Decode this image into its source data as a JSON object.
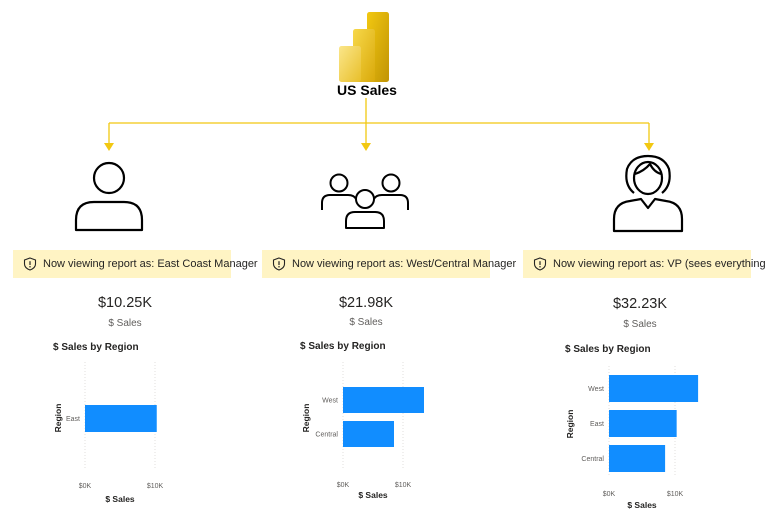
{
  "app": {
    "title": "US Sales",
    "icon": "power-bi-logo-icon",
    "connector_color": "#F2C811"
  },
  "personas": [
    {
      "id": "east",
      "icon": "single-person-icon",
      "banner": "Now viewing report as: East Coast Manager",
      "card": {
        "value": "$10.25K",
        "label": "$ Sales"
      }
    },
    {
      "id": "west",
      "icon": "group-people-icon",
      "banner": "Now viewing report as: West/Central Manager",
      "card": {
        "value": "$21.98K",
        "label": "$ Sales"
      }
    },
    {
      "id": "vp",
      "icon": "woman-person-icon",
      "banner": "Now viewing report as: VP (sees everything)",
      "card": {
        "value": "$32.23K",
        "label": "$ Sales"
      }
    }
  ],
  "chart_data": [
    {
      "type": "bar",
      "orientation": "horizontal",
      "title": "$ Sales by Region",
      "xlabel": "$ Sales",
      "ylabel": "Region",
      "categories": [
        "East"
      ],
      "values": [
        10.25
      ],
      "x_ticks": [
        "$0K",
        "$10K"
      ],
      "xlim": [
        0,
        10
      ],
      "grid": true,
      "bar_color": "#118DFF"
    },
    {
      "type": "bar",
      "orientation": "horizontal",
      "title": "$ Sales by Region",
      "xlabel": "$ Sales",
      "ylabel": "Region",
      "categories": [
        "West",
        "Central"
      ],
      "values": [
        13.5,
        8.5
      ],
      "x_ticks": [
        "$0K",
        "$10K"
      ],
      "xlim": [
        0,
        10
      ],
      "grid": true,
      "bar_color": "#118DFF"
    },
    {
      "type": "bar",
      "orientation": "horizontal",
      "title": "$ Sales by Region",
      "xlabel": "$ Sales",
      "ylabel": "Region",
      "categories": [
        "West",
        "East",
        "Central"
      ],
      "values": [
        13.5,
        10.25,
        8.5
      ],
      "x_ticks": [
        "$0K",
        "$10K"
      ],
      "xlim": [
        0,
        10
      ],
      "grid": true,
      "bar_color": "#118DFF"
    }
  ]
}
